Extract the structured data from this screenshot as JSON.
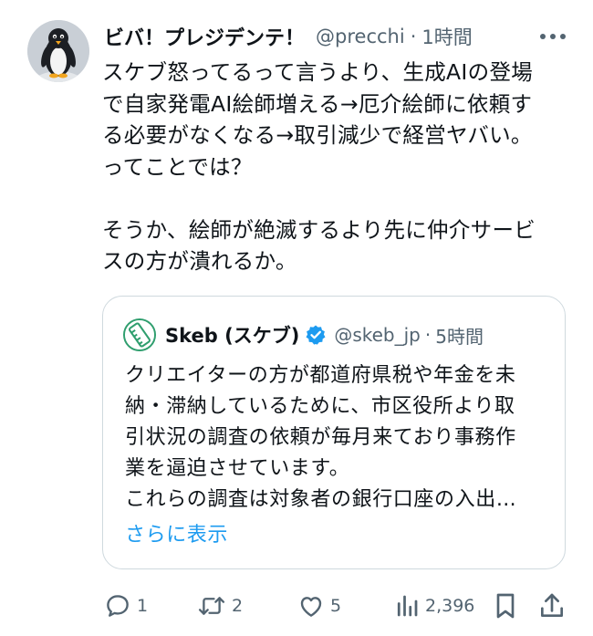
{
  "tweet": {
    "author": {
      "display_name": "ビバ！プレジデンテ！",
      "handle": "@precchi",
      "separator": "·",
      "time": "1時間",
      "avatar_icon": "penguin-avatar"
    },
    "text": "スケブ怒ってるって言うより、生成AIの登場\nで自家発電AI絵師増える→厄介絵師に依頼す\nる必要がなくなる→取引減少で経営ヤバい。\nってことでは？\n\nそうか、絵師が絶滅するより先に仲介サービ\nスの方が潰れるか。",
    "more_icon": "more-horizontal-icon"
  },
  "quote": {
    "author": {
      "display_name": "Skeb (スケブ)",
      "handle": "@skeb_jp",
      "separator": "·",
      "time": "5時間",
      "verified_icon": "verified-badge-icon",
      "verified_color": "#1d9bf0"
    },
    "text": "クリエイターの方が都道府県税や年金を未\n納・滞納しているために、市区役所より取\n引状況の調査の依頼が毎月来ており事務作\n業を逼迫させています。\nこれらの調査は対象者の銀行口座の入出…",
    "show_more": "さらに表示"
  },
  "actions": {
    "reply_count": "1",
    "retweet_count": "2",
    "like_count": "5",
    "views_count": "2,396"
  },
  "colors": {
    "text": "#0f1419",
    "secondary": "#536471",
    "link": "#1d9bf0",
    "border": "#cfd9de"
  }
}
